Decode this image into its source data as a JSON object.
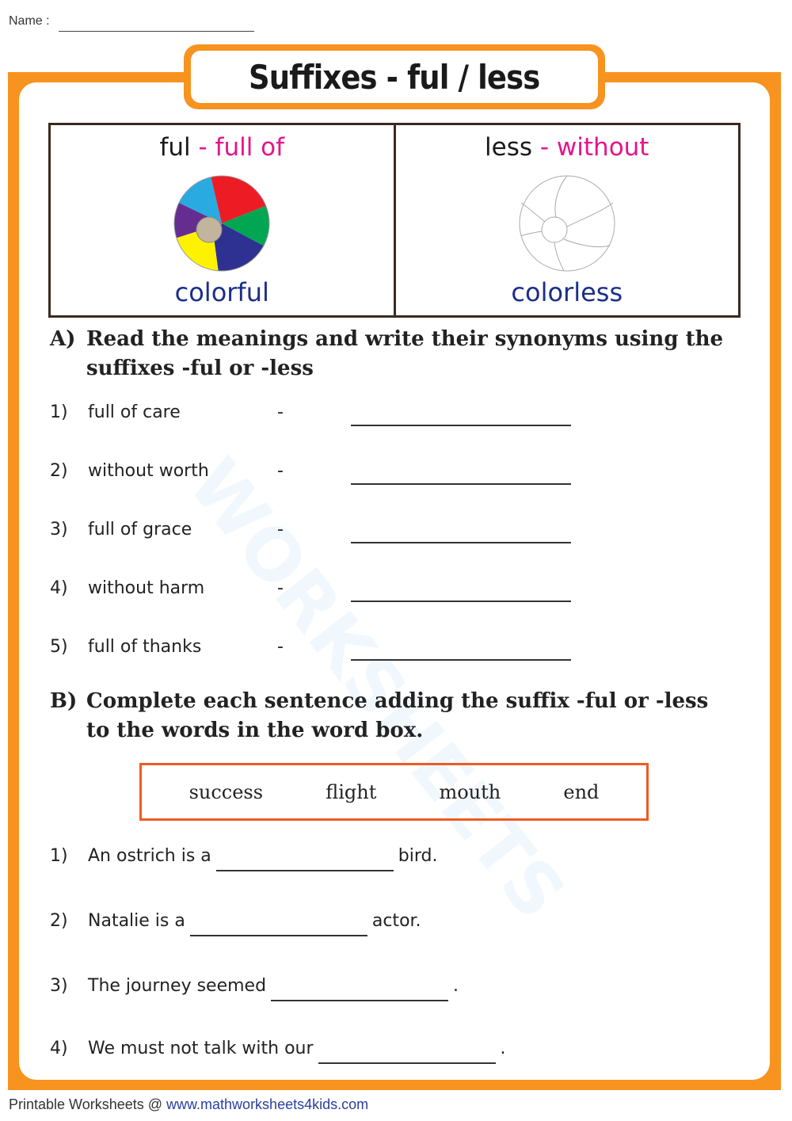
{
  "header": {
    "name_label": "Name :",
    "title": "Suffixes - ful / less"
  },
  "comparison": [
    {
      "suffix": "ful",
      "separator": " - ",
      "meaning": "full of",
      "example": "colorful",
      "image": "colored-beach-ball"
    },
    {
      "suffix": "less",
      "separator": " - ",
      "meaning": "without",
      "example": "colorless",
      "image": "uncolored-beach-ball"
    }
  ],
  "colors": {
    "frame_orange": "#f7931e",
    "wordbox_border": "#f15a24",
    "meaning_pink": "#e5148c",
    "example_blue": "#1b2e8a",
    "ball": [
      "#29abe2",
      "#ed1c24",
      "#00a651",
      "#2e3192",
      "#fff200",
      "#662d91",
      "#c2b59b"
    ]
  },
  "section_a": {
    "label": "A)",
    "instruction": "Read the meanings and write their synonyms using the suffixes -ful or -less",
    "items": [
      {
        "num": "1)",
        "text": "full of care",
        "dash": "-"
      },
      {
        "num": "2)",
        "text": "without worth",
        "dash": "-"
      },
      {
        "num": "3)",
        "text": "full of grace",
        "dash": "-"
      },
      {
        "num": "4)",
        "text": "without harm",
        "dash": "-"
      },
      {
        "num": "5)",
        "text": "full of thanks",
        "dash": "-"
      }
    ]
  },
  "section_b": {
    "label": "B)",
    "instruction": "Complete each sentence adding the suffix -ful or -less to the words in the word box.",
    "word_box": [
      "success",
      "flight",
      "mouth",
      "end"
    ],
    "sentences": [
      {
        "num": "1)",
        "before": "An ostrich is a",
        "after": "bird."
      },
      {
        "num": "2)",
        "before": "Natalie is a",
        "after": "actor."
      },
      {
        "num": "3)",
        "before": "The journey seemed",
        "after": "."
      },
      {
        "num": "4)",
        "before": "We must not talk with our",
        "after": "."
      }
    ]
  },
  "watermark": "WORKSHEETS",
  "footer": {
    "prefix": "Printable Worksheets @ ",
    "url": "www.mathworksheets4kids.com"
  }
}
